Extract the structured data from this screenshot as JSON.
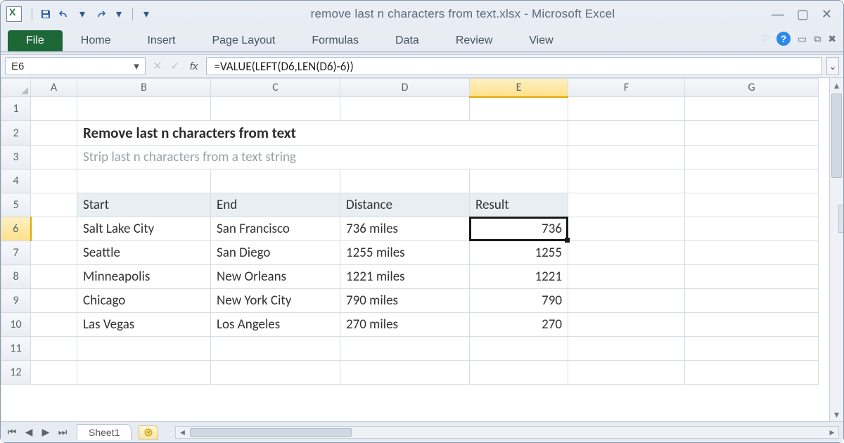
{
  "window": {
    "title": "remove last n characters from text.xlsx  -  Microsoft Excel"
  },
  "ribbon": {
    "file": "File",
    "tabs": [
      "Home",
      "Insert",
      "Page Layout",
      "Formulas",
      "Data",
      "Review",
      "View"
    ]
  },
  "formula_bar": {
    "name_box": "E6",
    "fx_label": "fx",
    "formula": "=VALUE(LEFT(D6,LEN(D6)-6))"
  },
  "columns": [
    "A",
    "B",
    "C",
    "D",
    "E",
    "F",
    "G"
  ],
  "rows_shown": [
    1,
    2,
    3,
    4,
    5,
    6,
    7,
    8,
    9,
    10,
    11,
    12
  ],
  "active_cell": {
    "col": "E",
    "row": 6
  },
  "sheet": {
    "title": "Remove last n characters from text",
    "subtitle": "Strip last n characters from a text string",
    "headers": [
      "Start",
      "End",
      "Distance",
      "Result"
    ],
    "data": [
      {
        "start": "Salt Lake City",
        "end": "San Francisco",
        "distance": "736 miles",
        "result": "736"
      },
      {
        "start": "Seattle",
        "end": "San Diego",
        "distance": "1255 miles",
        "result": "1255"
      },
      {
        "start": "Minneapolis",
        "end": "New Orleans",
        "distance": "1221 miles",
        "result": "1221"
      },
      {
        "start": "Chicago",
        "end": "New York City",
        "distance": "790 miles",
        "result": "790"
      },
      {
        "start": "Las Vegas",
        "end": "Los Angeles",
        "distance": "270 miles",
        "result": "270"
      }
    ]
  },
  "tabs": {
    "sheet1": "Sheet1"
  }
}
